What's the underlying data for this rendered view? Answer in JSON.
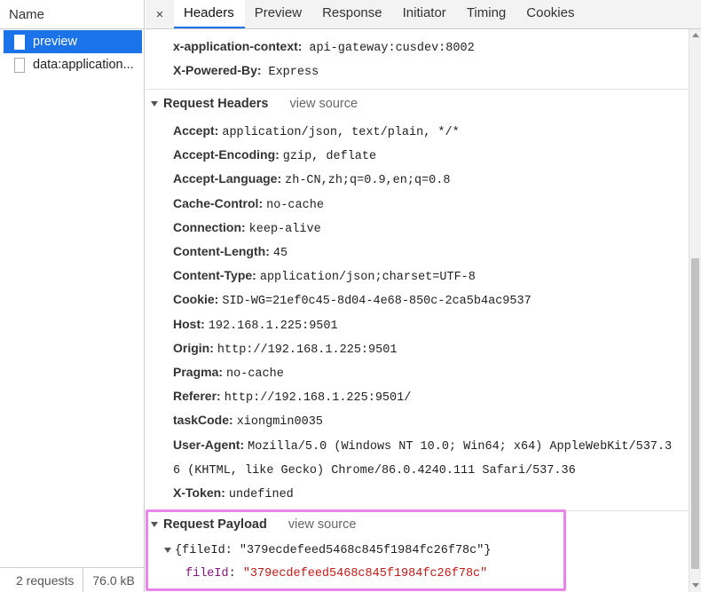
{
  "left_panel": {
    "header": "Name",
    "requests": [
      {
        "label": "preview",
        "selected": true
      },
      {
        "label": "data:application...",
        "selected": false
      }
    ],
    "status": {
      "count": "2 requests",
      "size": "76.0 kB"
    }
  },
  "tabs": {
    "close": "×",
    "items": [
      "Headers",
      "Preview",
      "Response",
      "Initiator",
      "Timing",
      "Cookies"
    ],
    "active": "Headers"
  },
  "response_headers_tail": [
    {
      "name": "x-application-context:",
      "value": "api-gateway:cusdev:8002"
    },
    {
      "name": "X-Powered-By:",
      "value": "Express"
    }
  ],
  "request_headers": {
    "title": "Request Headers",
    "view_source": "view source",
    "rows": [
      {
        "name": "Accept:",
        "value": "application/json, text/plain, */*"
      },
      {
        "name": "Accept-Encoding:",
        "value": "gzip, deflate"
      },
      {
        "name": "Accept-Language:",
        "value": "zh-CN,zh;q=0.9,en;q=0.8"
      },
      {
        "name": "Cache-Control:",
        "value": "no-cache"
      },
      {
        "name": "Connection:",
        "value": "keep-alive"
      },
      {
        "name": "Content-Length:",
        "value": "45"
      },
      {
        "name": "Content-Type:",
        "value": "application/json;charset=UTF-8"
      },
      {
        "name": "Cookie:",
        "value": "SID-WG=21ef0c45-8d04-4e68-850c-2ca5b4ac9537"
      },
      {
        "name": "Host:",
        "value": "192.168.1.225:9501"
      },
      {
        "name": "Origin:",
        "value": "http://192.168.1.225:9501"
      },
      {
        "name": "Pragma:",
        "value": "no-cache"
      },
      {
        "name": "Referer:",
        "value": "http://192.168.1.225:9501/"
      },
      {
        "name": "taskCode:",
        "value": "xiongmin0035"
      },
      {
        "name": "User-Agent:",
        "value": "Mozilla/5.0 (Windows NT 10.0; Win64; x64) AppleWebKit/537.3"
      },
      {
        "name": "",
        "value": "6 (KHTML, like Gecko) Chrome/86.0.4240.111 Safari/537.36"
      },
      {
        "name": "X-Token:",
        "value": "undefined"
      }
    ]
  },
  "request_payload": {
    "title": "Request Payload",
    "view_source": "view source",
    "summary": "{fileId: \"379ecdefeed5468c845f1984fc26f78c\"}",
    "key": "fileId",
    "value": "\"379ecdefeed5468c845f1984fc26f78c\"",
    "highlight_color": "#e985e9"
  },
  "colors": {
    "selected": "#1a73e8",
    "json_key": "#881280",
    "json_string": "#c41a16"
  }
}
